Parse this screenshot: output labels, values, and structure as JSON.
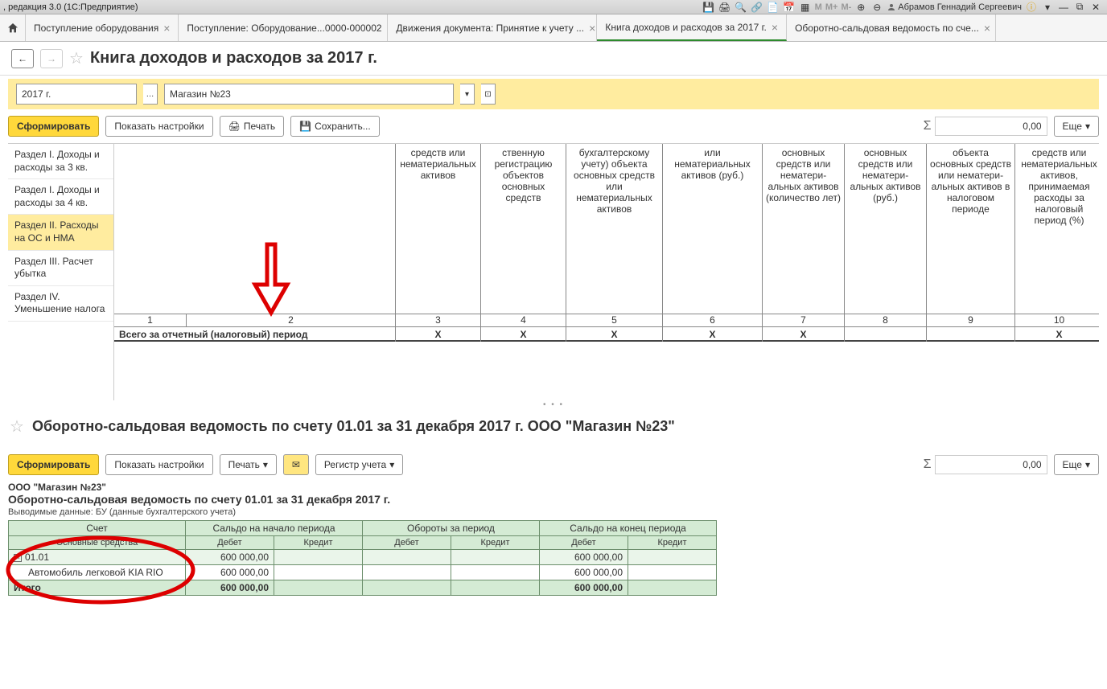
{
  "app_title": ", редакция 3.0  (1С:Предприятие)",
  "user_name": "Абрамов Геннадий Сергеевич",
  "tabs": [
    {
      "label": "Поступление оборудования"
    },
    {
      "label": "Поступление: Оборудование...0000-000002"
    },
    {
      "label": "Движения документа: Принятие к учету ..."
    },
    {
      "label": "Книга доходов и расходов за 2017 г.",
      "active": true
    },
    {
      "label": "Оборотно-сальдовая ведомость по сче..."
    }
  ],
  "page_title": "Книга доходов и расходов за 2017 г.",
  "period_value": "2017 г.",
  "org_value": "Магазин №23",
  "toolbar": {
    "form": "Сформировать",
    "show_settings": "Показать настройки",
    "print": "Печать",
    "save": "Сохранить...",
    "more": "Еще",
    "sum_value": "0,00"
  },
  "sidebar": {
    "items": [
      {
        "label": "Раздел I. Доходы и расходы за 3 кв."
      },
      {
        "label": "Раздел I. Доходы и расходы за 4 кв."
      },
      {
        "label": "Раздел II. Расходы на ОС и НМА",
        "active": true
      },
      {
        "label": "Раздел III. Расчет убытка"
      },
      {
        "label": "Раздел IV. Уменьшение налога"
      }
    ]
  },
  "report": {
    "col_heads": [
      "средств или немате­ри­альных активов",
      "ственную регистрацию объектов основных средств",
      "бухгалтерскому учету) объекта основных средств или нематериальных активов",
      "или нематериальных активов (руб.)",
      "основных средств или немате­ри­альных активов (количество лет)",
      "основных средств или немате­ри­альных активов (руб.)",
      "объекта основных средств или немате­ри­альных активов в налоговом периоде",
      "средств или немате­ри­альных активов, принимаемая расходы за налоговый период (%)"
    ],
    "col_numbers": [
      "1",
      "2",
      "3",
      "4",
      "5",
      "6",
      "7",
      "8",
      "9",
      "10"
    ],
    "total_label": "Всего за отчетный  (налоговый) период",
    "total_marks": [
      "X",
      "X",
      "X",
      "X",
      "X",
      "X"
    ]
  },
  "page2": {
    "title": "Оборотно-сальдовая ведомость по счету 01.01 за 31 декабря 2017 г. ООО \"Магазин №23\"",
    "toolbar": {
      "form": "Сформировать",
      "show_settings": "Показать настройки",
      "print": "Печать",
      "register": "Регистр учета",
      "more": "Еще",
      "sum_value": "0,00"
    },
    "org": "ООО \"Магазин №23\"",
    "heading": "Оборотно-сальдовая ведомость по счету 01.01 за 31 декабря 2017 г.",
    "subheading": "Выводимые данные:   БУ (данные бухгалтерского учета)",
    "table": {
      "cols": [
        "Счет",
        "Сальдо на начало периода",
        "Обороты за период",
        "Сальдо на конец периода"
      ],
      "cols2": [
        "Основные средства",
        "Дебет",
        "Кредит",
        "Дебет",
        "Кредит",
        "Дебет",
        "Кредит"
      ],
      "rows": [
        {
          "acct": "01.01",
          "deb_start": "600 000,00",
          "deb_end": "600 000,00"
        },
        {
          "acct": "Автомобиль легковой KIA RIO",
          "deb_start": "600 000,00",
          "deb_end": "600 000,00"
        }
      ],
      "total_label": "Итого",
      "total_deb_start": "600 000,00",
      "total_deb_end": "600 000,00"
    }
  }
}
